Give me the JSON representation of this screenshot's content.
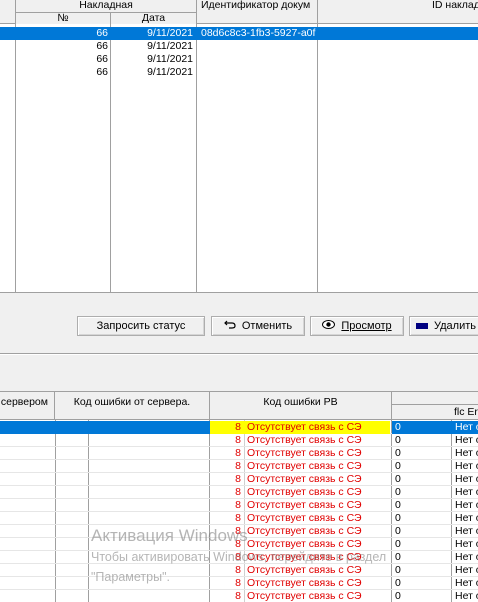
{
  "top_grid": {
    "group_header": "Накладная",
    "col_num": "№",
    "col_date": "Дата",
    "col_doc_id": "Идентификатор докум",
    "col_invoice_id": "ID наклад",
    "rows": [
      {
        "num": "66",
        "date": "9/11/2021",
        "doc_id": "08d6c8c3-1fb3-5927-a0f",
        "selected": true
      },
      {
        "num": "66",
        "date": "9/11/2021",
        "doc_id": "",
        "selected": false
      },
      {
        "num": "66",
        "date": "9/11/2021",
        "doc_id": "",
        "selected": false
      },
      {
        "num": "66",
        "date": "9/11/2021",
        "doc_id": "",
        "selected": false
      }
    ]
  },
  "toolbar": {
    "request_status": "Запросить статус",
    "cancel": "Отменить",
    "view": "Просмотр",
    "delete": "Удалить"
  },
  "bottom_grid": {
    "col_server": "сервером",
    "col_server_error": "Код ошибки от сервера.",
    "col_rb_error": "Код ошибки РВ",
    "col_flc": "flc Er",
    "rows": [
      {
        "code": "8",
        "text": "Отсутствует связь с СЭ",
        "f0": "0",
        "f1": "Нет о",
        "selected": true
      },
      {
        "code": "8",
        "text": "Отсутствует связь с СЭ",
        "f0": "0",
        "f1": "Нет о",
        "selected": false
      },
      {
        "code": "8",
        "text": "Отсутствует связь с СЭ",
        "f0": "0",
        "f1": "Нет о",
        "selected": false
      },
      {
        "code": "8",
        "text": "Отсутствует связь с СЭ",
        "f0": "0",
        "f1": "Нет о",
        "selected": false
      },
      {
        "code": "8",
        "text": "Отсутствует связь с СЭ",
        "f0": "0",
        "f1": "Нет о",
        "selected": false
      },
      {
        "code": "8",
        "text": "Отсутствует связь с СЭ",
        "f0": "0",
        "f1": "Нет о",
        "selected": false
      },
      {
        "code": "8",
        "text": "Отсутствует связь с СЭ",
        "f0": "0",
        "f1": "Нет о",
        "selected": false
      },
      {
        "code": "8",
        "text": "Отсутствует связь с СЭ",
        "f0": "0",
        "f1": "Нет о",
        "selected": false
      },
      {
        "code": "8",
        "text": "Отсутствует связь с СЭ",
        "f0": "0",
        "f1": "Нет о",
        "selected": false
      },
      {
        "code": "8",
        "text": "Отсутствует связь с СЭ",
        "f0": "0",
        "f1": "Нет о",
        "selected": false
      },
      {
        "code": "8",
        "text": "Отсутствует связь с СЭ",
        "f0": "0",
        "f1": "Нет о",
        "selected": false
      },
      {
        "code": "8",
        "text": "Отсутствует связь с СЭ",
        "f0": "0",
        "f1": "Нет о",
        "selected": false
      },
      {
        "code": "8",
        "text": "Отсутствует связь с СЭ",
        "f0": "0",
        "f1": "Нет о",
        "selected": false
      },
      {
        "code": "8",
        "text": "Отсутствует связь с СЭ",
        "f0": "0",
        "f1": "Нет о",
        "selected": false
      },
      {
        "code": "8",
        "text": "Отсутствует связь с СЭ",
        "f0": "0",
        "f1": "Нет о",
        "selected": false
      }
    ]
  },
  "watermark": {
    "line1": "Активация Windows",
    "line2": "Чтобы активировать Windows, перейдите в раздел",
    "line3": "\"Параметры\"."
  },
  "colors": {
    "selection": "#0078d7",
    "highlight": "#ffff00",
    "error_text": "#e00000"
  }
}
